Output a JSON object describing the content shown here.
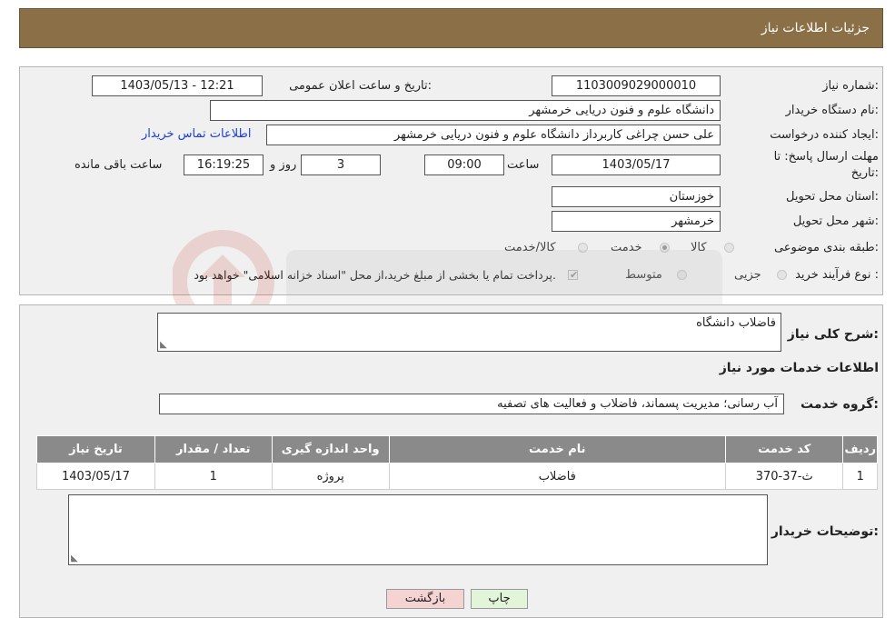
{
  "header": {
    "title": "جزئیات اطلاعات نیاز"
  },
  "form": {
    "need_number_label": "شماره نیاز:",
    "need_number": "1103009029000010",
    "announce_label": "تاریخ و ساعت اعلان عمومی:",
    "announce_value": "1403/05/13 - 12:21",
    "buyer_org_label": "نام دستگاه خریدار:",
    "buyer_org": "دانشگاه علوم و فنون دریایی خرمشهر",
    "requester_label": "ایجاد کننده درخواست:",
    "requester": "علی حسن چراغی کاربرداز دانشگاه علوم و فنون دریایی خرمشهر",
    "contact_link": "اطلاعات تماس خریدار",
    "deadline_label_1": "مهلت ارسال پاسخ: تا",
    "deadline_label_2": "تاریخ:",
    "deadline_date": "1403/05/17",
    "time_label": "ساعت",
    "deadline_time": "09:00",
    "days_value": "3",
    "days_label": "روز و",
    "remaining_time": "16:19:25",
    "remaining_label": "ساعت باقی مانده",
    "province_label": "استان محل تحویل:",
    "province": "خوزستان",
    "city_label": "شهر محل تحویل:",
    "city": "خرمشهر",
    "category_label": "طبقه بندی موضوعی:",
    "category_options": [
      "کالا",
      "خدمت",
      "کالا/خدمت"
    ],
    "category_selected": "خدمت",
    "process_label": "نوع فرآیند خرید :",
    "process_options": [
      "جزیی",
      "متوسط"
    ],
    "payment_note": "پرداخت تمام یا بخشی از مبلغ خرید،از محل \"اسناد خزانه اسلامی\" خواهد بود."
  },
  "details": {
    "summary_label": "شرح کلی نیاز:",
    "summary_value": "فاضلاب دانشگاه",
    "services_heading": "اطلاعات خدمات مورد نیاز",
    "service_group_label": "گروه خدمت:",
    "service_group_value": "آب رسانی؛ مدیریت پسماند، فاضلاب و فعالیت های تصفیه",
    "table": {
      "headers": [
        "ردیف",
        "کد خدمت",
        "نام خدمت",
        "واحد اندازه گیری",
        "تعداد / مقدار",
        "تاریخ نیاز"
      ],
      "rows": [
        [
          "1",
          "ث-37-370",
          "فاضلاب",
          "پروژه",
          "1",
          "1403/05/17"
        ]
      ]
    },
    "buyer_notes_label": "توضیحات خریدار:",
    "buyer_notes_value": ""
  },
  "buttons": {
    "print": "چاپ",
    "back": "بازگشت"
  },
  "colors": {
    "header_bg": "#8B6F47",
    "table_header_bg": "#8a8a8a",
    "link": "#1a3fd8"
  }
}
